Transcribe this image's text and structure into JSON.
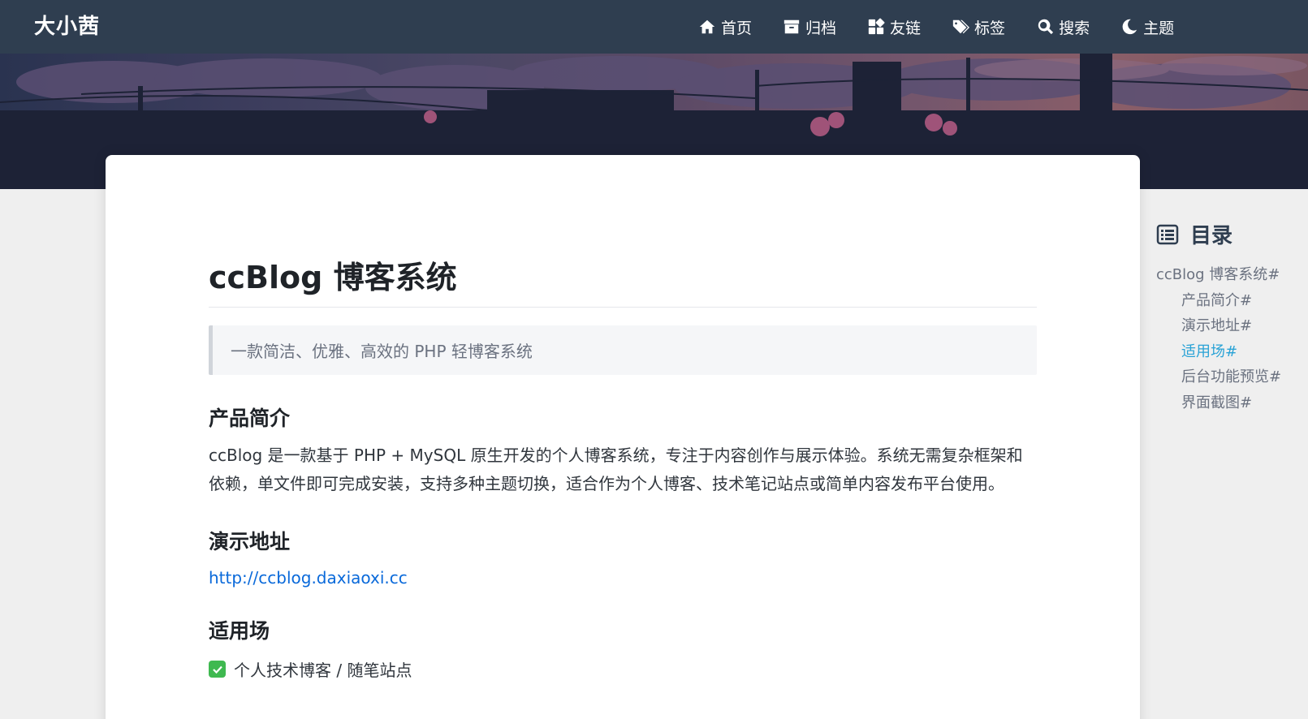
{
  "site": {
    "brand": "大小茜"
  },
  "nav": {
    "items": [
      {
        "label": "首页",
        "icon": "home-icon"
      },
      {
        "label": "归档",
        "icon": "archive-icon"
      },
      {
        "label": "友链",
        "icon": "apps-icon"
      },
      {
        "label": "标签",
        "icon": "tags-icon"
      },
      {
        "label": "搜索",
        "icon": "search-icon"
      },
      {
        "label": "主题",
        "icon": "moon-icon"
      }
    ]
  },
  "post": {
    "title": "ccBlog 博客系统",
    "quote": "一款简洁、优雅、高效的 PHP 轻博客系统",
    "sections": {
      "intro_heading": "产品简介",
      "intro_text": "ccBlog 是一款基于 PHP + MySQL 原生开发的个人博客系统，专注于内容创作与展示体验。系统无需复杂框架和依赖，单文件即可完成安装，支持多种主题切换，适合作为个人博客、技术笔记站点或简单内容发布平台使用。",
      "demo_heading": "演示地址",
      "demo_link": "http://ccblog.daxiaoxi.cc",
      "usage_heading": "适用场",
      "usage_item_1": "个人技术博客 / 随笔站点"
    }
  },
  "toc": {
    "title": "目录",
    "items": [
      {
        "label": "ccBlog 博客系统#",
        "level": 1
      },
      {
        "label": "产品简介#",
        "level": 2
      },
      {
        "label": "演示地址#",
        "level": 2
      },
      {
        "label": "适用场#",
        "level": 2,
        "active": true
      },
      {
        "label": "后台功能预览#",
        "level": 2
      },
      {
        "label": "界面截图#",
        "level": 2
      }
    ]
  },
  "colors": {
    "navbar": "#2f3e50",
    "link": "#0969da",
    "toc_active": "#2aa3d6",
    "check": "#3fb950"
  }
}
